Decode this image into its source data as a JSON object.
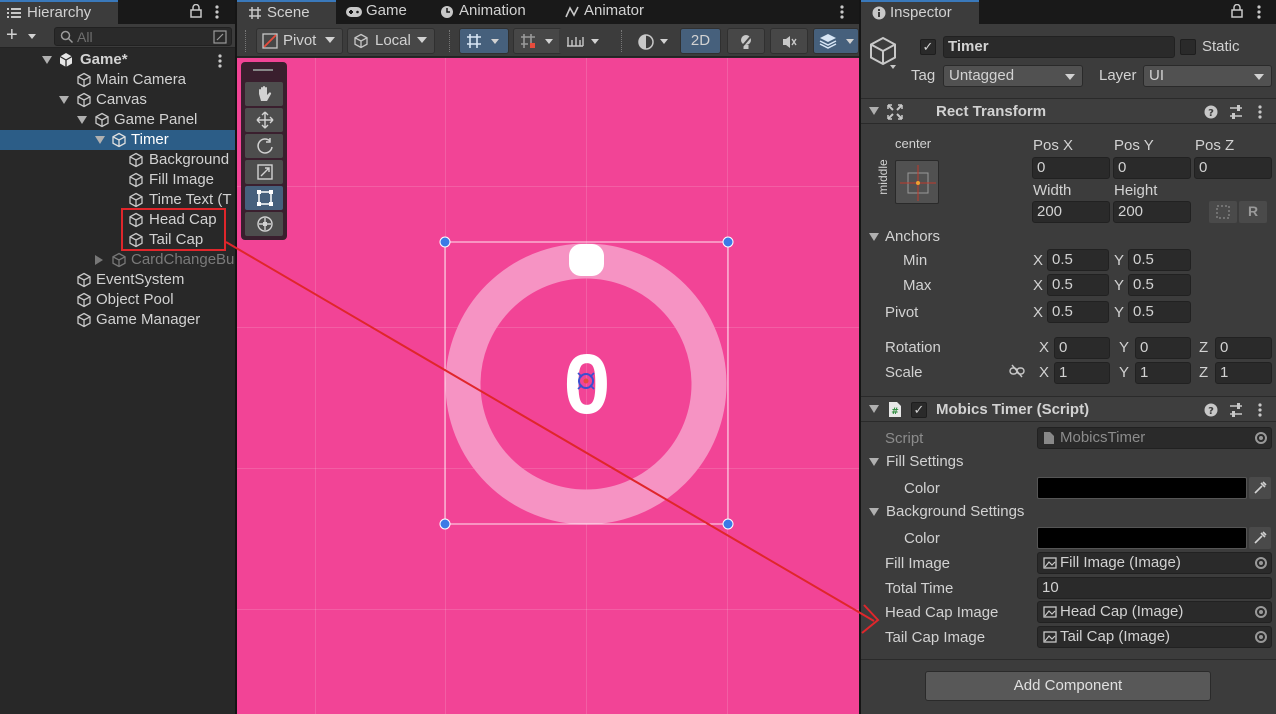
{
  "hierarchy": {
    "tab_label": "Hierarchy",
    "search_placeholder": "All",
    "add_label": "+",
    "items": [
      {
        "label": "Game*"
      },
      {
        "label": "Main Camera"
      },
      {
        "label": "Canvas"
      },
      {
        "label": "Game Panel"
      },
      {
        "label": "Timer"
      },
      {
        "label": "Background"
      },
      {
        "label": "Fill Image"
      },
      {
        "label": "Time Text (T"
      },
      {
        "label": "Head Cap"
      },
      {
        "label": "Tail Cap"
      },
      {
        "label": "CardChangeBu"
      },
      {
        "label": "EventSystem"
      },
      {
        "label": "Object Pool"
      },
      {
        "label": "Game Manager"
      }
    ]
  },
  "tabs": {
    "scene": "Scene",
    "game": "Game",
    "animation": "Animation",
    "animator": "Animator"
  },
  "scene_toolbar": {
    "pivot": "Pivot",
    "local": "Local",
    "mode_2d": "2D"
  },
  "scene_view": {
    "timer_digit": "0"
  },
  "inspector": {
    "tab_label": "Inspector",
    "object_name": "Timer",
    "static_label": "Static",
    "tag_label": "Tag",
    "tag_value": "Untagged",
    "layer_label": "Layer",
    "layer_value": "UI",
    "rect_transform": {
      "title": "Rect Transform",
      "anchor_h": "center",
      "anchor_v": "middle",
      "pos_x_label": "Pos X",
      "pos_x": "0",
      "pos_y_label": "Pos Y",
      "pos_y": "0",
      "pos_z_label": "Pos Z",
      "pos_z": "0",
      "width_label": "Width",
      "width": "200",
      "height_label": "Height",
      "height": "200",
      "anchors_label": "Anchors",
      "min_label": "Min",
      "min_x": "0.5",
      "min_y": "0.5",
      "max_label": "Max",
      "max_x": "0.5",
      "max_y": "0.5",
      "pivot_label": "Pivot",
      "pivot_x": "0.5",
      "pivot_y": "0.5",
      "rotation_label": "Rotation",
      "rot_x": "0",
      "rot_y": "0",
      "rot_z": "0",
      "scale_label": "Scale",
      "scale_x": "1",
      "scale_y": "1",
      "scale_z": "1",
      "x": "X",
      "y": "Y",
      "z": "Z"
    },
    "script_component": {
      "title": "Mobics Timer (Script)",
      "script_label": "Script",
      "script_value": "MobicsTimer",
      "fill_settings": "Fill Settings",
      "color_label": "Color",
      "background_settings": "Background Settings",
      "fill_image_label": "Fill Image",
      "fill_image_value": "Fill Image (Image)",
      "total_time_label": "Total Time",
      "total_time_value": "10",
      "head_cap_label": "Head Cap Image",
      "head_cap_value": "Head Cap (Image)",
      "tail_cap_label": "Tail Cap Image",
      "tail_cap_value": "Tail Cap (Image)"
    },
    "add_component": "Add Component"
  },
  "colors": {
    "viewport": "#f24496",
    "selection": "#2c5d87",
    "annotation": "#e0262b",
    "fill_color": "#000000",
    "background_color": "#000000"
  }
}
